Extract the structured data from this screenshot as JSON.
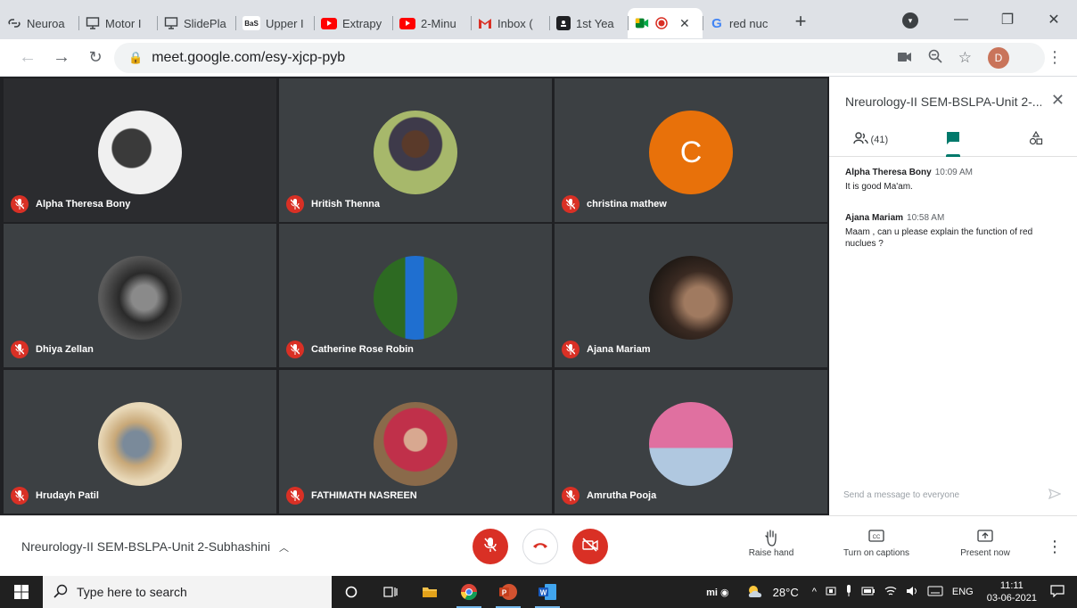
{
  "browser": {
    "tabs": [
      {
        "label": "Neuroa",
        "icon": "link-icon",
        "color": "#3c4043"
      },
      {
        "label": "Motor I",
        "icon": "slides-icon",
        "color": "#3c4043"
      },
      {
        "label": "SlidePla",
        "icon": "slides-icon",
        "color": "#3c4043"
      },
      {
        "label": "Upper I",
        "icon": "bas-icon",
        "fav_text": "BaS",
        "color": "#202124"
      },
      {
        "label": "Extrapy",
        "icon": "youtube-icon",
        "color": "#ff0000"
      },
      {
        "label": "2-Minu",
        "icon": "youtube-icon",
        "color": "#ff0000"
      },
      {
        "label": "Inbox (",
        "icon": "gmail-icon",
        "color": "#d93025"
      },
      {
        "label": "1st Yea",
        "icon": "classroom-icon",
        "color": "#202124"
      },
      {
        "label": "red nuc",
        "icon": "google-icon",
        "color": "#4285f4"
      }
    ],
    "active_tab_close": "✕",
    "new_tab": "+",
    "url": "meet.google.com/esy-xjcp-pyb",
    "profile_initial": "D"
  },
  "participants": [
    {
      "name": "Alpha Theresa Bony",
      "type": "photo",
      "colors": [
        "#e8e8e8",
        "#3a3a3a"
      ]
    },
    {
      "name": "Hritish Thenna",
      "type": "photo",
      "colors": [
        "#a7b86b",
        "#3e3a4a"
      ]
    },
    {
      "name": "christina mathew",
      "type": "letter",
      "letter": "C"
    },
    {
      "name": "Dhiya Zellan",
      "type": "photo",
      "colors": [
        "#6b6b6b",
        "#1e1e1e"
      ]
    },
    {
      "name": "Catherine Rose Robin",
      "type": "photo",
      "colors": [
        "#3d7a2b",
        "#1f6fd0"
      ]
    },
    {
      "name": "Ajana Mariam",
      "type": "photo",
      "colors": [
        "#3a2a22",
        "#a07a60"
      ]
    },
    {
      "name": "Hrudayh Patil",
      "type": "photo",
      "colors": [
        "#e8d8b8",
        "#7a8a9a"
      ]
    },
    {
      "name": "FATHIMATH NASREEN",
      "type": "photo",
      "colors": [
        "#8a6a4a",
        "#c0304a"
      ]
    },
    {
      "name": "Amrutha Pooja",
      "type": "photo",
      "colors": [
        "#e070a0",
        "#b0c8e0"
      ]
    }
  ],
  "panel": {
    "title": "Nreurology-II SEM-BSLPA-Unit 2-...",
    "people_count": "(41)",
    "messages": [
      {
        "author": "Alpha Theresa Bony",
        "time": "10:09 AM",
        "text": "It is good Ma'am."
      },
      {
        "author": "Ajana Mariam",
        "time": "10:58 AM",
        "text": "Maam , can u please explain the function of red nuclues ?"
      }
    ],
    "send_placeholder": "Send a message to everyone"
  },
  "bottombar": {
    "meeting_name": "Nreurology-II SEM-BSLPA-Unit 2-Subhashini",
    "raise_hand": "Raise hand",
    "captions": "Turn on captions",
    "present": "Present now"
  },
  "taskbar": {
    "search_placeholder": "Type here to search",
    "weather": "28°C",
    "lang": "ENG",
    "time": "11:11",
    "date": "03-06-2021"
  },
  "colors": {
    "mic_off": "#d93025",
    "accent": "#00796b",
    "letter_avatar": "#e8710a"
  }
}
